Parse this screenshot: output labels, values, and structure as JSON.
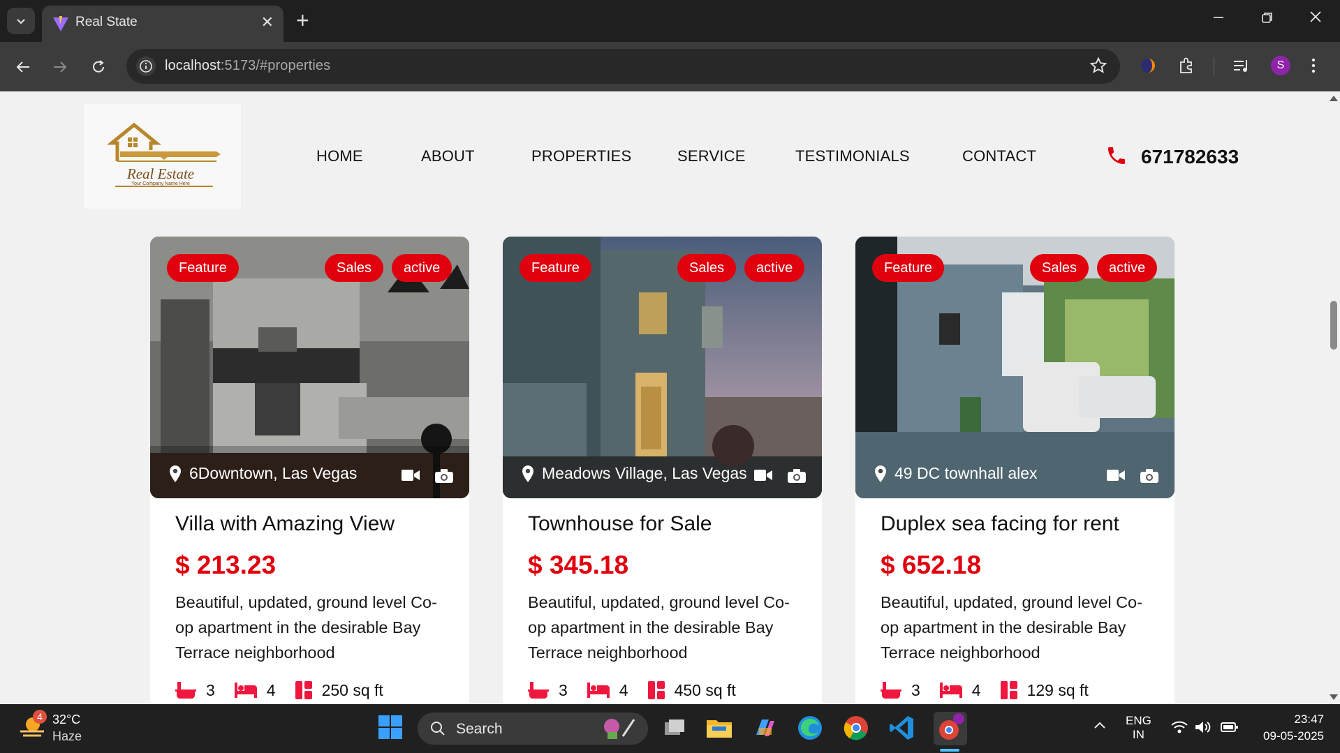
{
  "browser": {
    "tab_title": "Real State",
    "url_host": "localhost",
    "url_rest": ":5173/#properties",
    "profile_initial": "S"
  },
  "site": {
    "logo_text": "Real Estate",
    "logo_subtext": "Your Company Name Here",
    "nav": [
      "HOME",
      "ABOUT",
      "PROPERTIES",
      "SERVICE",
      "TESTIMONIALS",
      "CONTACT"
    ],
    "phone": "671782633"
  },
  "cards": [
    {
      "badges": [
        "Feature",
        "Sales",
        "active"
      ],
      "location": "6Downtown, Las Vegas",
      "title": "Villa with Amazing View",
      "price": "$ 213.23",
      "description": "Beautiful, updated, ground level Co-op apartment in the desirable Bay Terrace neighborhood",
      "baths": "3",
      "beds": "4",
      "area": "250 sq ft"
    },
    {
      "badges": [
        "Feature",
        "Sales",
        "active"
      ],
      "location": "Meadows Village, Las Vegas",
      "title": "Townhouse for Sale",
      "price": "$ 345.18",
      "description": "Beautiful, updated, ground level Co-op apartment in the desirable Bay Terrace neighborhood",
      "baths": "3",
      "beds": "4",
      "area": "450 sq ft"
    },
    {
      "badges": [
        "Feature",
        "Sales",
        "active"
      ],
      "location": "49 DC townhall alex",
      "title": "Duplex sea facing for rent",
      "price": "$ 652.18",
      "description": "Beautiful, updated, ground level Co-op apartment in the desirable Bay Terrace neighborhood",
      "baths": "3",
      "beds": "4",
      "area": "129 sq ft"
    }
  ],
  "taskbar": {
    "weather_badge": "4",
    "temperature": "32°C",
    "condition": "Haze",
    "search_label": "Search",
    "lang_top": "ENG",
    "lang_bottom": "IN",
    "time": "23:47",
    "date": "09-05-2025"
  },
  "colors": {
    "accent_red": "#e0000e",
    "chrome_dark": "#1f1f1f",
    "toolbar": "#3c3c3c",
    "page_bg": "#f1f1f1"
  },
  "icons": [
    "location-pin-icon",
    "video-icon",
    "camera-icon",
    "bathtub-icon",
    "bed-icon",
    "area-icon",
    "phone-icon"
  ]
}
